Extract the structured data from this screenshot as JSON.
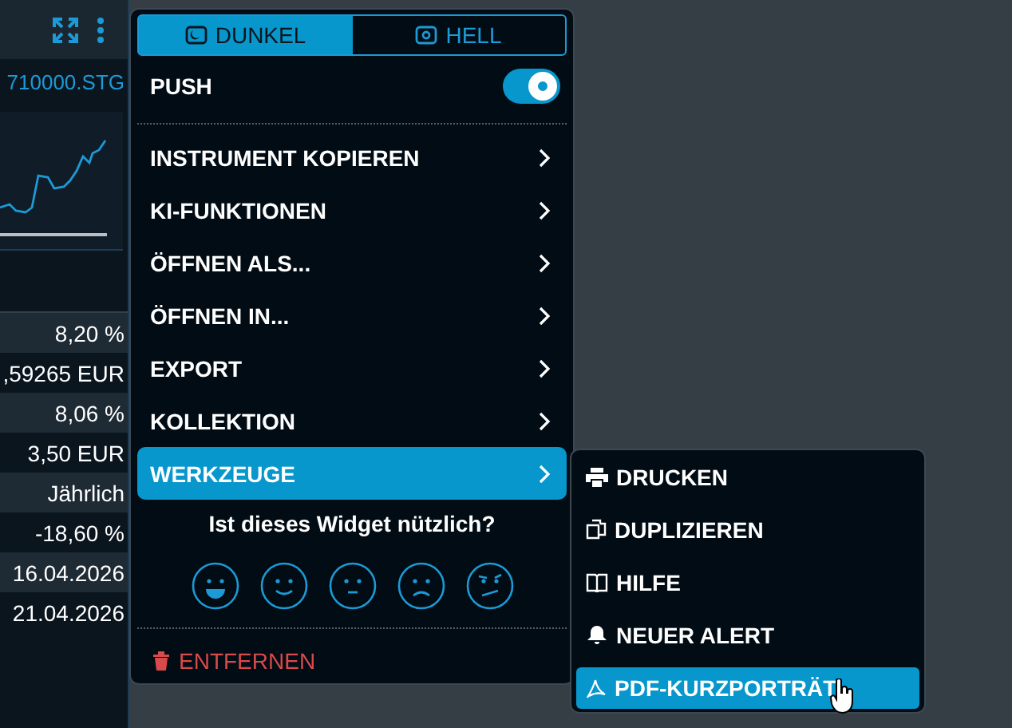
{
  "widget": {
    "symbol": "710000.STG",
    "rows": [
      {
        "value": "8,20 %"
      },
      {
        "value": ",59265 EUR"
      },
      {
        "value": "8,06 %"
      },
      {
        "value": "3,50 EUR"
      },
      {
        "value": "Jährlich"
      },
      {
        "value": "-18,60 %"
      },
      {
        "value": "16.04.2026"
      },
      {
        "value": "21.04.2026"
      }
    ]
  },
  "menu": {
    "theme_tabs": [
      {
        "label": "DUNKEL",
        "selected": true
      },
      {
        "label": "HELL",
        "selected": false
      }
    ],
    "push": {
      "label": "PUSH",
      "on": true
    },
    "items": [
      {
        "label": "INSTRUMENT KOPIEREN",
        "selected": false
      },
      {
        "label": "KI-FUNKTIONEN",
        "selected": false
      },
      {
        "label": "ÖFFNEN ALS...",
        "selected": false
      },
      {
        "label": "ÖFFNEN IN...",
        "selected": false
      },
      {
        "label": "EXPORT",
        "selected": false
      },
      {
        "label": "KOLLEKTION",
        "selected": false
      },
      {
        "label": "WERKZEUGE",
        "selected": true
      }
    ],
    "feedback": {
      "question": "Ist dieses Widget nützlich?"
    },
    "remove": "ENTFERNEN"
  },
  "submenu": {
    "items": [
      {
        "label": "DRUCKEN",
        "kind": "print",
        "selected": false
      },
      {
        "label": "DUPLIZIEREN",
        "kind": "duplicate",
        "selected": false
      },
      {
        "label": "HILFE",
        "kind": "book",
        "selected": false
      },
      {
        "label": "NEUER ALERT",
        "kind": "bell",
        "selected": false
      },
      {
        "label": "PDF-KURZPORTRÄT",
        "kind": "pdf",
        "selected": true
      }
    ]
  }
}
